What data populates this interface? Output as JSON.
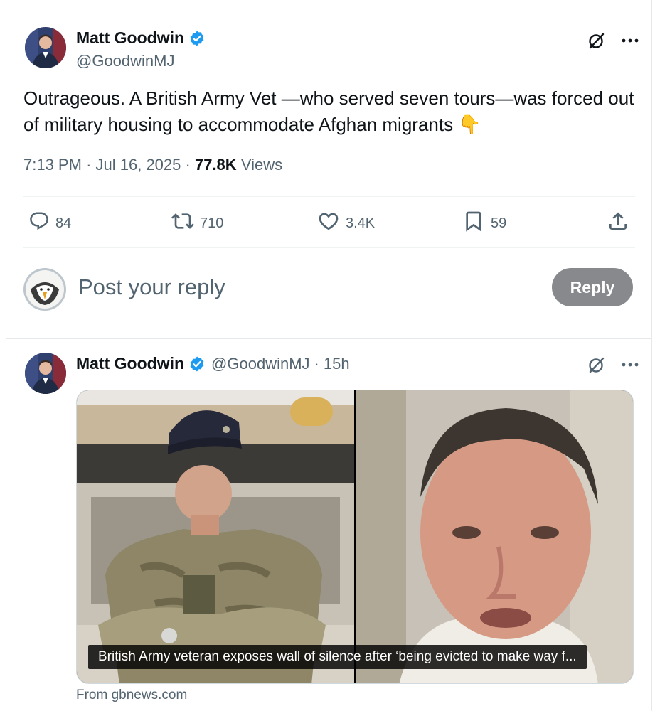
{
  "main_tweet": {
    "author_name": "Matt Goodwin",
    "author_handle": "@GoodwinMJ",
    "text": "Outrageous. A British Army Vet —who served seven tours—was forced out of military housing to accommodate Afghan migrants 👇",
    "time": "7:13 PM",
    "date": "Jul 16, 2025",
    "views_count": "77.8K",
    "views_label": "Views",
    "replies": "84",
    "reposts": "710",
    "likes": "3.4K",
    "bookmarks": "59"
  },
  "reply_box": {
    "placeholder": "Post your reply",
    "button_label": "Reply"
  },
  "quoted_tweet": {
    "author_name": "Matt Goodwin",
    "author_handle": "@GoodwinMJ",
    "separator": "·",
    "age": "15h",
    "card_caption": "British Army veteran exposes wall of silence after ‘being evicted to make way f...",
    "card_source": "From gbnews.com"
  },
  "icons": {
    "verified": "verified-badge-icon",
    "grok": "grok-icon",
    "more": "more-icon",
    "reply": "reply-icon",
    "repost": "repost-icon",
    "like": "heart-icon",
    "bookmark": "bookmark-icon",
    "share": "share-icon"
  },
  "colors": {
    "text_primary": "#0f1419",
    "text_secondary": "#536471",
    "verified_blue": "#1d9bf0",
    "reply_button_bg": "#87898c",
    "divider": "#eff3f4"
  }
}
